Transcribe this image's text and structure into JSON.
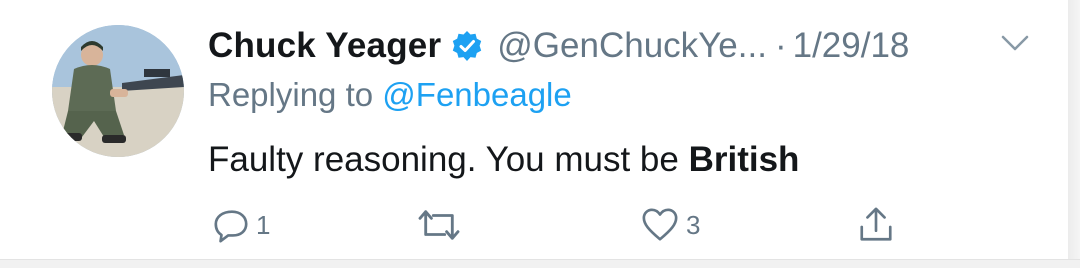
{
  "tweet": {
    "author_name": "Chuck Yeager",
    "author_handle": "@GenChuckYe...",
    "separator": "·",
    "date": "1/29/18",
    "replying_prefix": "Replying to",
    "replying_to": "@Fenbeagle",
    "text_plain": "Faulty reasoning. You must be",
    "text_bold": "British",
    "verified": true
  },
  "actions": {
    "reply_count": "1",
    "retweet_count": "",
    "like_count": "3"
  },
  "colors": {
    "accent": "#1da1f2",
    "secondary_text": "#657786",
    "primary_text": "#14171a"
  },
  "icons": [
    "verified-badge-icon",
    "chevron-down-icon",
    "reply-icon",
    "retweet-icon",
    "like-icon",
    "share-icon"
  ]
}
